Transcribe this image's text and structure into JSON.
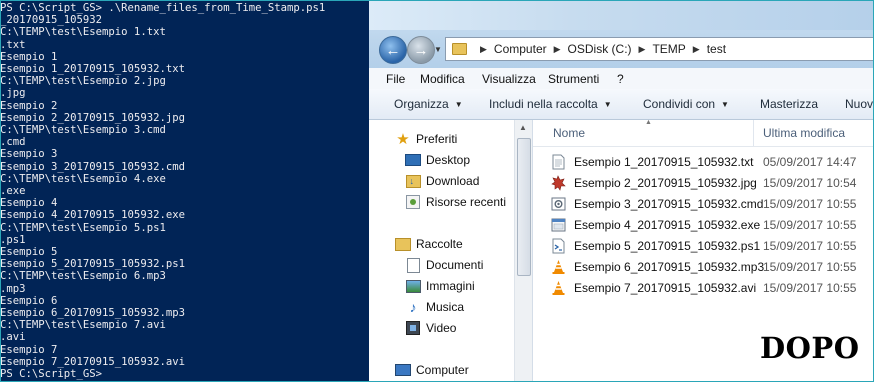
{
  "console": {
    "lines": [
      "PS C:\\Script_GS> .\\Rename_files_from_Time_Stamp.ps1",
      "_20170915_105932",
      "C:\\TEMP\\test\\Esempio 1.txt",
      ".txt",
      "Esempio 1",
      "Esempio 1_20170915_105932.txt",
      "C:\\TEMP\\test\\Esempio 2.jpg",
      ".jpg",
      "Esempio 2",
      "Esempio 2_20170915_105932.jpg",
      "C:\\TEMP\\test\\Esempio 3.cmd",
      ".cmd",
      "Esempio 3",
      "Esempio 3_20170915_105932.cmd",
      "C:\\TEMP\\test\\Esempio 4.exe",
      ".exe",
      "Esempio 4",
      "Esempio 4_20170915_105932.exe",
      "C:\\TEMP\\test\\Esempio 5.ps1",
      ".ps1",
      "Esempio 5",
      "Esempio 5_20170915_105932.ps1",
      "C:\\TEMP\\test\\Esempio 6.mp3",
      ".mp3",
      "Esempio 6",
      "Esempio 6_20170915_105932.mp3",
      "C:\\TEMP\\test\\Esempio 7.avi",
      ".avi",
      "Esempio 7",
      "Esempio 7_20170915_105932.avi",
      "PS C:\\Script_GS>"
    ],
    "background": "#012456",
    "foreground": "#eeedf0"
  },
  "explorer": {
    "address": [
      "Computer",
      "OSDisk (C:)",
      "TEMP",
      "test"
    ],
    "menu": [
      "File",
      "Modifica",
      "Visualizza",
      "Strumenti",
      "?"
    ],
    "toolbar": {
      "organize": "Organizza",
      "include": "Includi nella raccolta",
      "share": "Condividi con",
      "burn": "Masterizza",
      "new": "Nuov"
    },
    "nav": {
      "favorites": "Preferiti",
      "desktop": "Desktop",
      "downloads": "Download",
      "recent": "Risorse recenti",
      "libraries": "Raccolte",
      "documents": "Documenti",
      "pictures": "Immagini",
      "music": "Musica",
      "video": "Video",
      "computer": "Computer"
    },
    "columns": {
      "name": "Nome",
      "modified": "Ultima modifica"
    },
    "files": [
      {
        "name": "Esempio 1_20170915_105932.txt",
        "modified": "05/09/2017 14:47",
        "icon": "text-file-icon"
      },
      {
        "name": "Esempio 2_20170915_105932.jpg",
        "modified": "15/09/2017 10:54",
        "icon": "image-file-icon"
      },
      {
        "name": "Esempio 3_20170915_105932.cmd",
        "modified": "15/09/2017 10:55",
        "icon": "batch-file-icon"
      },
      {
        "name": "Esempio 4_20170915_105932.exe",
        "modified": "15/09/2017 10:55",
        "icon": "exe-file-icon"
      },
      {
        "name": "Esempio 5_20170915_105932.ps1",
        "modified": "15/09/2017 10:55",
        "icon": "ps1-file-icon"
      },
      {
        "name": "Esempio 6_20170915_105932.mp3",
        "modified": "15/09/2017 10:55",
        "icon": "vlc-cone-icon"
      },
      {
        "name": "Esempio 7_20170915_105932.avi",
        "modified": "15/09/2017 10:55",
        "icon": "vlc-cone-icon"
      }
    ]
  },
  "overlay_label": "DOPO",
  "colors": {
    "frame": "#2aa6b8",
    "folder": "#e8c35b",
    "vlc_orange": "#f08a00"
  }
}
